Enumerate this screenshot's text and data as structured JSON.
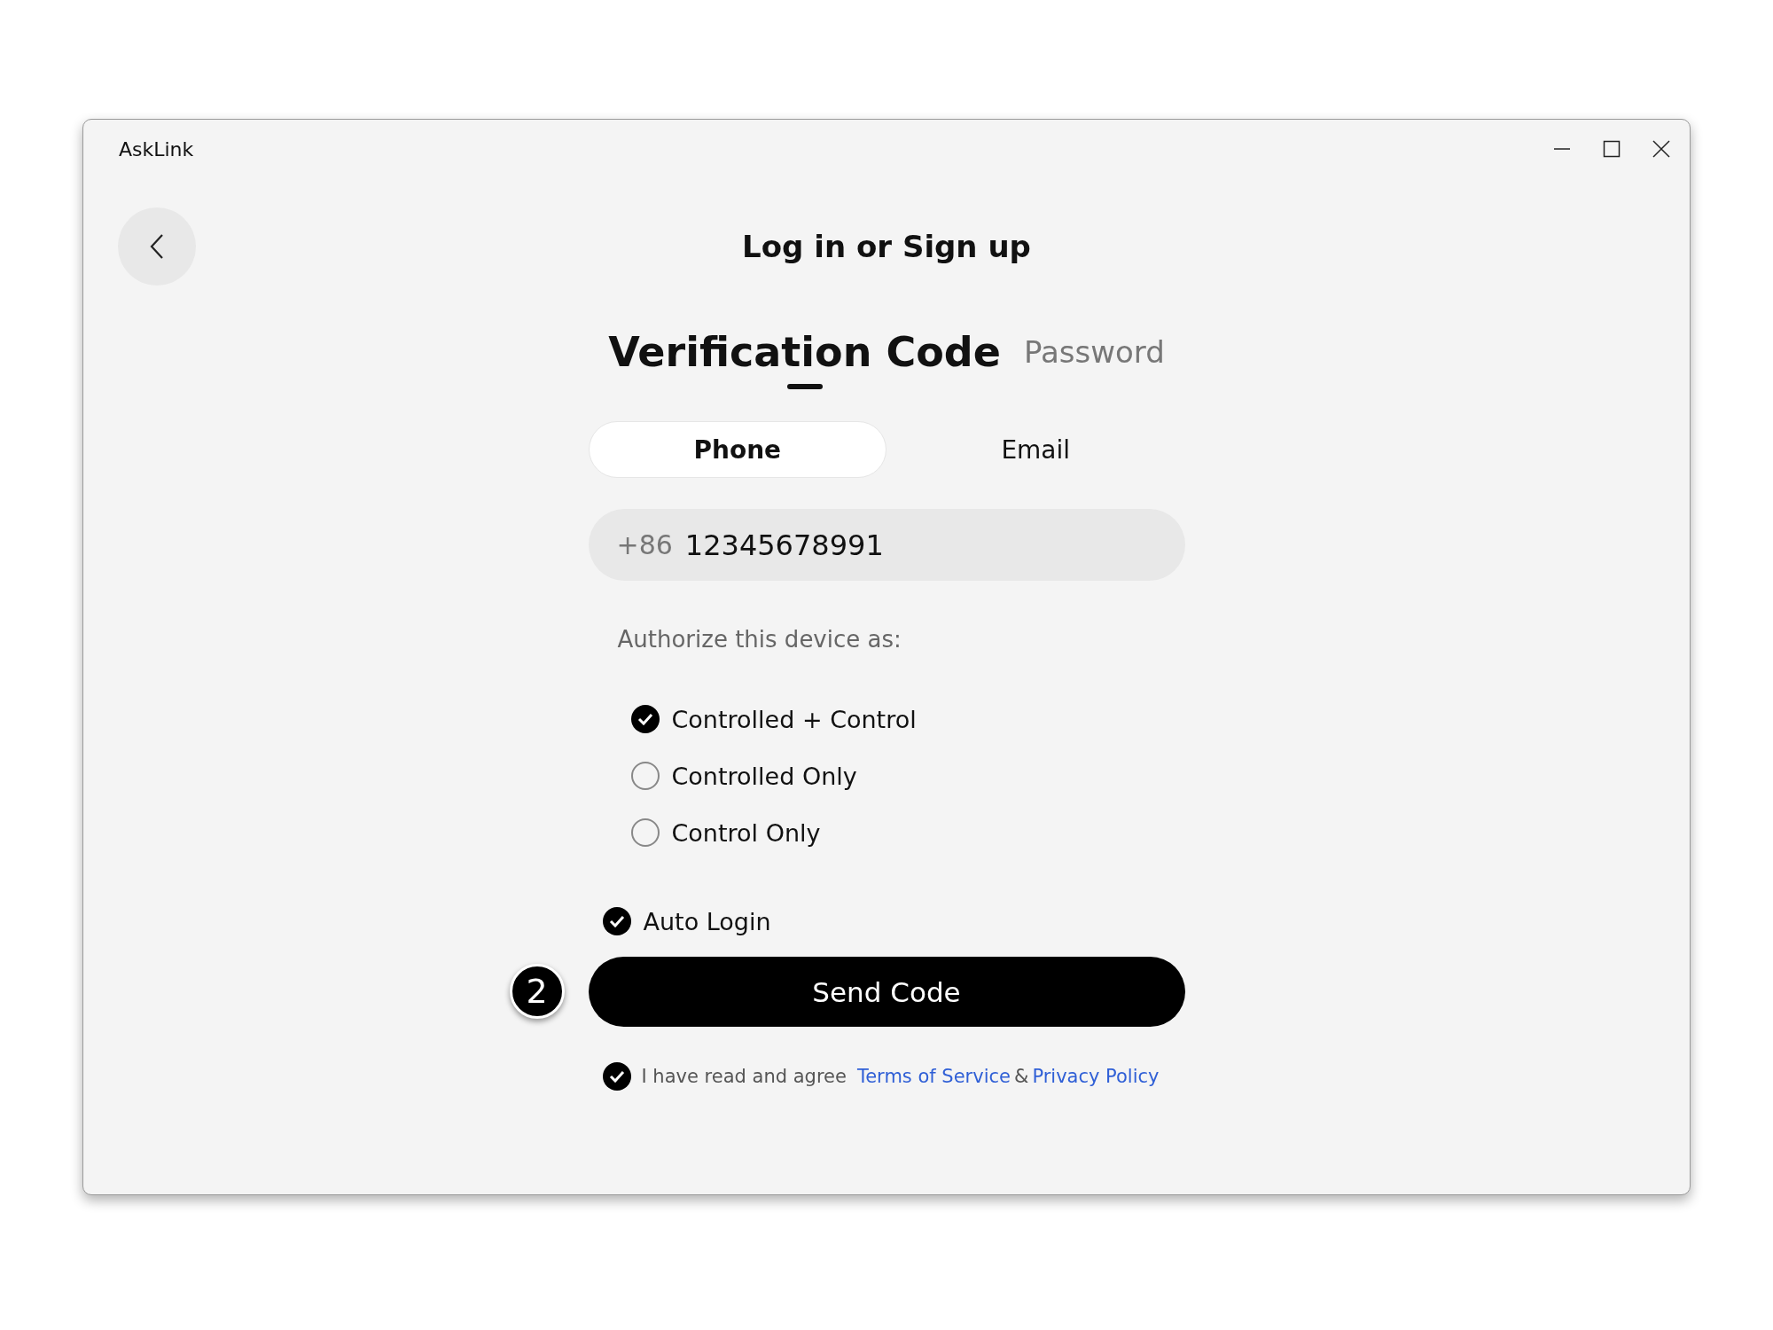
{
  "window": {
    "title": "AskLink"
  },
  "heading": "Log in or Sign up",
  "mode_tabs": [
    {
      "label": "Verification Code",
      "selected": true
    },
    {
      "label": "Password",
      "selected": false
    }
  ],
  "contact_tabs": [
    {
      "label": "Phone",
      "selected": true
    },
    {
      "label": "Email",
      "selected": false
    }
  ],
  "phone_field": {
    "prefix": "+86",
    "value": "12345678991"
  },
  "authorize": {
    "label": "Authorize this device as:",
    "options": [
      {
        "label": "Controlled + Control",
        "selected": true
      },
      {
        "label": "Controlled Only",
        "selected": false
      },
      {
        "label": "Control Only",
        "selected": false
      }
    ]
  },
  "auto_login": {
    "label": "Auto Login",
    "checked": true
  },
  "send_button": {
    "label": "Send Code",
    "step_badge": "2"
  },
  "agreement": {
    "checked": true,
    "text": "I have read and agree",
    "links": [
      "Terms of Service",
      "Privacy Policy"
    ],
    "separator": "&"
  }
}
